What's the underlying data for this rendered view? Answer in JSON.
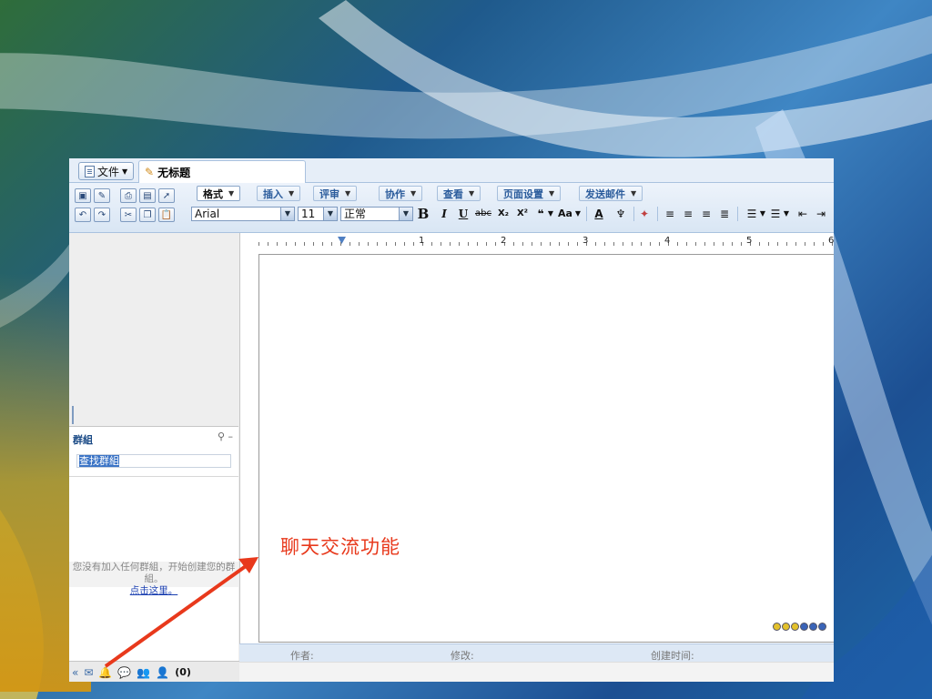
{
  "tabs": {
    "file_menu": "文件",
    "document_title": "无标题"
  },
  "menus": [
    {
      "label": "格式",
      "active": true
    },
    {
      "label": "插入"
    },
    {
      "label": "评审"
    },
    {
      "label": "协作"
    },
    {
      "label": "查看"
    },
    {
      "label": "页面设置"
    },
    {
      "label": "发送邮件"
    }
  ],
  "format": {
    "font_family": "Arial",
    "font_size": "11",
    "style": "正常",
    "bold": "B",
    "italic": "I",
    "underline": "U",
    "strike": "abc",
    "subscript": "X₂",
    "superscript": "X²",
    "quote": "❝",
    "case": "Aa",
    "font_color": "A"
  },
  "ruler": {
    "numbers": [
      "1",
      "2",
      "3",
      "4",
      "5",
      "6"
    ]
  },
  "groups_panel": {
    "title": "群組",
    "search_value": "查找群組",
    "empty_message": "您没有加入任何群組，开始创建您的群組。",
    "create_link": "点击这里。"
  },
  "bottom_bar": {
    "count": "(0)"
  },
  "status_bar": {
    "author_label": "作者:",
    "modified_label": "修改:",
    "created_label": "创建时间:"
  },
  "annotation": {
    "text": "聊天交流功能",
    "color": "#e8391c"
  },
  "colors": {
    "accent": "#2b5c9c",
    "toolbar_bg": "#d9e6f4"
  }
}
